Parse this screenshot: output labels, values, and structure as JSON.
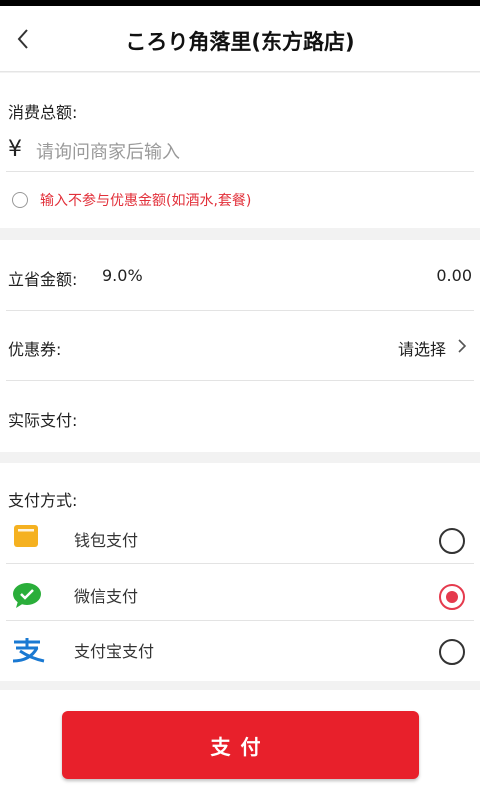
{
  "header": {
    "title": "ころり角落里(东方路店)"
  },
  "amount": {
    "label": "消费总额:",
    "currency_symbol": "¥",
    "placeholder": "请询问商家后输入",
    "value": "",
    "exclude_label": "输入不参与优惠金额(如酒水,套餐)",
    "exclude_checked": false
  },
  "discount": {
    "label": "立省金额:",
    "rate": "9.0%",
    "amount": "0.00"
  },
  "coupon": {
    "label": "优惠券:",
    "action": "请选择"
  },
  "actual": {
    "label": "实际支付:",
    "value": ""
  },
  "payment": {
    "title": "支付方式:",
    "methods": [
      {
        "label": "钱包支付",
        "icon": "wallet-icon",
        "selected": false
      },
      {
        "label": "微信支付",
        "icon": "wechat-icon",
        "selected": true
      },
      {
        "label": "支付宝支付",
        "icon": "alipay-icon",
        "selected": false
      }
    ]
  },
  "pay_button": {
    "label": "支付"
  },
  "colors": {
    "accent_red": "#e8202b",
    "warn_red": "#e2303a",
    "radio_selected": "#e53a4d",
    "wallet_yellow": "#f5b120",
    "wechat_green": "#2aae3a",
    "alipay_blue": "#1a79d2"
  }
}
